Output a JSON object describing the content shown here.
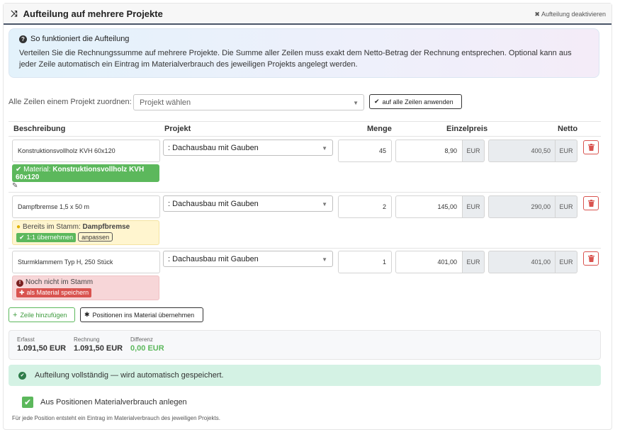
{
  "header": {
    "title": "Aufteilung auf mehrere Projekte",
    "deactivate_label": "Aufteilung deaktivieren",
    "icon": "shuffle-icon"
  },
  "info": {
    "title": "So funktioniert die Aufteilung",
    "text": "Verteilen Sie die Rechnungssumme auf mehrere Projekte. Die Summe aller Zeilen muss exakt dem Netto-Betrag der Rechnung entsprechen. Optional kann aus jeder Zeile automatisch ein Eintrag im Materialverbrauch des jeweiligen Projekts angelegt werden."
  },
  "assign_all": {
    "label": "Alle Zeilen einem Projekt zuordnen:",
    "select_placeholder": "Projekt wählen",
    "apply_label": "auf alle Zeilen anwenden"
  },
  "table": {
    "headers": {
      "beschreibung": "Beschreibung",
      "projekt": "Projekt",
      "menge": "Menge",
      "einzelpreis": "Einzelpreis",
      "netto": "Netto"
    },
    "currency": "EUR",
    "rows": [
      {
        "beschreibung": "Konstruktionsvollholz KVH 60x120",
        "projekt": ": Dachausbau mit Gauben",
        "menge": "45",
        "einzelpreis": "8,90",
        "netto": "400,50",
        "status": {
          "prefix": "Material: ",
          "name": "Konstruktionsvollholz KVH 60x120"
        }
      },
      {
        "beschreibung": "Dampfbremse 1,5 x 50 m",
        "projekt": ": Dachausbau mit Gauben",
        "menge": "2",
        "einzelpreis": "145,00",
        "netto": "290,00",
        "status": {
          "prefix": "Bereits im Stamm: ",
          "name": "Dampfbremse",
          "accept_label": "1:1 übernehmen",
          "adjust_label": "anpassen"
        }
      },
      {
        "beschreibung": "Sturmklammern Typ H, 250 Stück",
        "projekt": ": Dachausbau mit Gauben",
        "menge": "1",
        "einzelpreis": "401,00",
        "netto": "401,00",
        "status": {
          "text": "Noch nicht im Stamm",
          "save_label": "als Material speichern"
        }
      }
    ]
  },
  "actions": {
    "add_row_label": "Zeile hinzufügen",
    "positions_label": "Positionen ins Material übernehmen"
  },
  "summary": {
    "erfasst_label": "Erfasst",
    "erfasst_value": "1.091,50 EUR",
    "rechnung_label": "Rechnung",
    "rechnung_value": "1.091,50 EUR",
    "differenz_label": "Differenz",
    "differenz_value": "0,00 EUR"
  },
  "alert": {
    "text": "Aufteilung vollständig — wird automatisch gespeichert."
  },
  "material_checkbox": {
    "checked": true,
    "label": "Aus Positionen Materialverbrauch anlegen",
    "hint": "Für jede Position entsteht ein Eintrag im Materialverbrauch des jeweiligen Projekts."
  },
  "colors": {
    "success": "#5cb85c",
    "danger": "#d9534f",
    "warning_bg": "#fff5cf",
    "danger_bg": "#f7d6d8",
    "success_bg": "#d4f2e4"
  }
}
